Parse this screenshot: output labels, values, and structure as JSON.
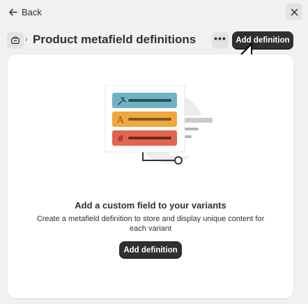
{
  "topbar": {
    "back_label": "Back",
    "back_icon": "arrow-left-icon",
    "close_icon": "close-icon"
  },
  "header": {
    "breadcrumb_icon": "product-icon",
    "breadcrumb_separator": "›",
    "title": "Product metafield definitions",
    "more_icon": "more-horizontal-icon",
    "more_label": "•••",
    "primary_action_label": "Add definition"
  },
  "empty_state": {
    "heading": "Add a custom field to your variants",
    "description": "Create a metafield definition to store and display unique content for each variant",
    "action_label": "Add definition",
    "illustration_rows": [
      {
        "icon": "eyedropper-icon",
        "color": "#6fb3c2"
      },
      {
        "icon": "text-icon",
        "color": "#f0a73d"
      },
      {
        "icon": "hash-icon",
        "color": "#e1654f"
      }
    ]
  },
  "colors": {
    "background": "#f1f1f1",
    "card": "#ffffff",
    "primary_button": "#303030",
    "text": "#303030"
  }
}
